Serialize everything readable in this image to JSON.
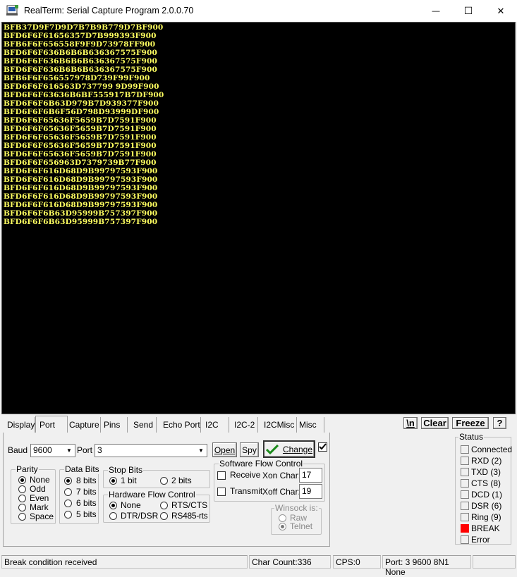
{
  "window": {
    "title": "RealTerm: Serial Capture Program 2.0.0.70",
    "minimize_glyph": "—",
    "maximize_glyph": "☐",
    "close_glyph": "✕"
  },
  "terminal": {
    "lines": [
      "BFB37D9F7D9D7B7B9B779D7BF900",
      "BFD6F6F61656357D7B999393F900",
      "BFB6F6F656558F9F9D73978FF900",
      "BFD6F6F636B6B6B636367575F900",
      "BFD6F6F636B6B6B636367575F900",
      "BFD6F6F636B6B6B636367575F900",
      "BFB6F6F656557978D739F99F900",
      "BFD6F6F616563D737799 9D99F900",
      "BFD6F6F63636B6BF555917B7DF900",
      "BFD6F6F6B63D979B7D939377F900",
      "BFD6F6F6B6F56D798D93999DF900",
      "BFD6F6F65636F5659B7D7591F900",
      "BFD6F6F65636F5659B7D7591F900",
      "BFD6F6F65636F5659B7D7591F900",
      "BFD6F6F65636F5659B7D7591F900",
      "BFD6F6F65636F5659B7D7591F900",
      "BFD6F6F656963D7379739B77F900",
      "BFD6F6F616D68D9B99797593F900",
      "BFD6F6F616D68D9B99797593F900",
      "BFD6F6F616D68D9B99797593F900",
      "BFD6F6F616D68D9B99797593F900",
      "BFD6F6F616D68D9B99797593F900",
      "BFD6F6F6B63D95999B757397F900",
      "BFD6F6F6B63D95999B757397F900"
    ]
  },
  "tabs": [
    "Display",
    "Port",
    "Capture",
    "Pins",
    "Send",
    "Echo Port",
    "I2C",
    "I2C-2",
    "I2CMisc",
    "Misc"
  ],
  "right_buttons": {
    "newline": "\\n",
    "clear": "Clear",
    "freeze": "Freeze",
    "help": "?"
  },
  "port": {
    "baud_label": "Baud",
    "baud_value": "9600",
    "port_label": "Port",
    "port_value": "3",
    "open_label": "Open",
    "spy_label": "Spy",
    "change_label": "Change",
    "parity": {
      "title": "Parity",
      "options": [
        "None",
        "Odd",
        "Even",
        "Mark",
        "Space"
      ],
      "selected": "None"
    },
    "data_bits": {
      "title": "Data Bits",
      "options": [
        "8 bits",
        "7 bits",
        "6 bits",
        "5 bits"
      ],
      "selected": "8 bits"
    },
    "stop_bits": {
      "title": "Stop Bits",
      "options": [
        "1 bit",
        "2 bits"
      ],
      "selected": "1 bit"
    },
    "hw_flow": {
      "title": "Hardware Flow Control",
      "options": [
        "None",
        "RTS/CTS",
        "DTR/DSR",
        "RS485-rts"
      ],
      "selected": "None"
    },
    "sw_flow": {
      "title": "Software Flow Control",
      "receive_label": "Receive",
      "transmit_label": "Transmit",
      "xon_label": "Xon Char:",
      "xon_value": "17",
      "xoff_label": "Xoff Char:",
      "xoff_value": "19"
    },
    "winsock": {
      "title": "Winsock is:",
      "options": [
        "Raw",
        "Telnet"
      ],
      "selected": "Telnet"
    }
  },
  "status": {
    "title": "Status",
    "items": [
      {
        "label": "Connected",
        "active": false
      },
      {
        "label": "RXD (2)",
        "active": false
      },
      {
        "label": "TXD (3)",
        "active": false
      },
      {
        "label": "CTS (8)",
        "active": false
      },
      {
        "label": "DCD (1)",
        "active": false
      },
      {
        "label": "DSR (6)",
        "active": false
      },
      {
        "label": "Ring (9)",
        "active": false
      },
      {
        "label": "BREAK",
        "active": true
      },
      {
        "label": "Error",
        "active": false
      }
    ],
    "active_color": "#ff0000"
  },
  "statusbar": {
    "message": "Break condition received",
    "char_count": "Char Count:336",
    "cps": "CPS:0",
    "port_info": "Port: 3 9600 8N1 None"
  },
  "colors": {
    "terminal_bg": "#000000",
    "terminal_fg": "#ffff60",
    "check_green": "#1a8a1a"
  }
}
